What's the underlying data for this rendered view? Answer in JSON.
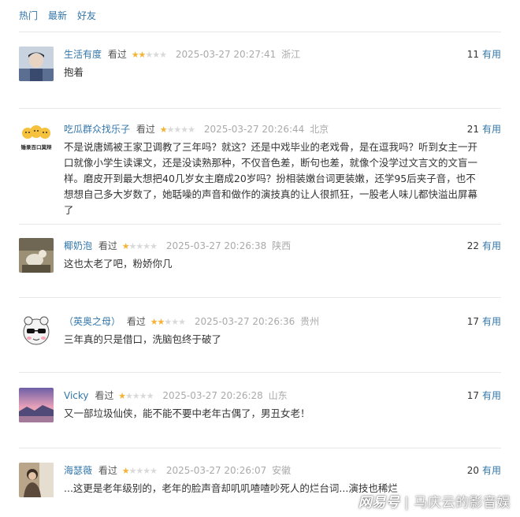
{
  "tabs": [
    {
      "label": "热门"
    },
    {
      "label": "最新"
    },
    {
      "label": "好友"
    }
  ],
  "vote_label": "有用",
  "comments": [
    {
      "user": "生活有度",
      "status": "看过",
      "rating": 2,
      "time": "2025-03-27 20:27:41",
      "location": "浙江",
      "votes": "11",
      "text": "抱着"
    },
    {
      "user": "吃瓜群众找乐子",
      "status": "看过",
      "rating": 1,
      "time": "2025-03-27 20:26:44",
      "location": "北京",
      "votes": "21",
      "text": "不是说唐嫣被王家卫调教了三年吗？就这？还是中戏毕业的老戏骨，是在逗我吗？听到女主一开口就像小学生读课文，还是没读熟那种，不仅音色差，断句也差，就像个没学过文言文的文盲一样。磨皮开到最大想把40几岁女主磨成20岁吗？扮相装嫩台词更装嫩，还学95后夹子音，也不想想自己多大岁数了，她聒噪的声音和做作的演技真的让人很抓狂，一股老人味儿都快溢出屏幕了"
    },
    {
      "user": "椰奶泡",
      "status": "看过",
      "rating": 1,
      "time": "2025-03-27 20:26:38",
      "location": "陕西",
      "votes": "22",
      "text": "这也太老了吧，粉娇你几"
    },
    {
      "user": "（英奥之母）",
      "status": "看过",
      "rating": 2,
      "time": "2025-03-27 20:26:36",
      "location": "贵州",
      "votes": "17",
      "text": "三年真的只是借口，洗脑包终于破了"
    },
    {
      "user": "Vicky",
      "status": "看过",
      "rating": 1,
      "time": "2025-03-27 20:26:28",
      "location": "山东",
      "votes": "17",
      "text": "又一部垃圾仙侠，能不能不要中老年古偶了，男丑女老！"
    },
    {
      "user": "海瑟薇",
      "status": "看过",
      "rating": 1,
      "time": "2025-03-27 20:26:07",
      "location": "安徽",
      "votes": "20",
      "text": "...这更是老年级别的，老年的脸声音却叽叽喳喳吵死人的烂台词...演技也稀烂"
    }
  ],
  "avatar2_caption": "锤录百口莫辩",
  "watermark": {
    "logo": "网易号",
    "separator": "|",
    "text": "马庆云的影音娱"
  },
  "colors": {
    "link": "#3377aa",
    "star": "#f5b335",
    "star_empty": "#d9d9d9",
    "meta": "#aaaaaa"
  }
}
